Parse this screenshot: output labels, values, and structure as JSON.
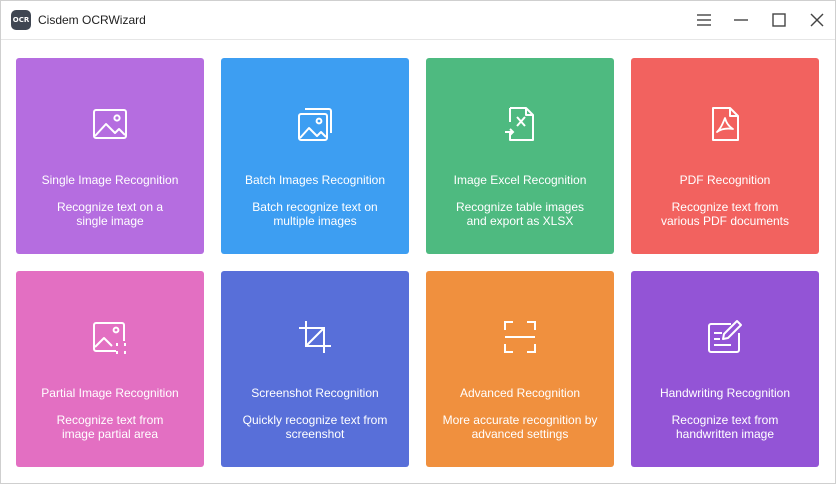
{
  "titlebar": {
    "logo_text": "OCR",
    "app_title": "Cisdem OCRWizard"
  },
  "colors": {
    "purple": "#b56de0",
    "blue": "#3d9ef2",
    "green": "#4eba80",
    "red": "#f2625f",
    "pink": "#e36fc2",
    "indigo": "#586fd9",
    "orange": "#f0903e",
    "violet": "#9354d6"
  },
  "cards": [
    {
      "title": "Single Image Recognition",
      "desc_line1": "Recognize text on a",
      "desc_line2": "single image",
      "icon": "image-icon",
      "color": "#b56de0"
    },
    {
      "title": "Batch Images Recognition",
      "desc_line1": "Batch recognize text on",
      "desc_line2": "multiple images",
      "icon": "images-stack-icon",
      "color": "#3d9ef2"
    },
    {
      "title": "Image Excel Recognition",
      "desc_line1": "Recognize table images",
      "desc_line2": "and export as XLSX",
      "icon": "excel-file-icon",
      "color": "#4eba80"
    },
    {
      "title": "PDF Recognition",
      "desc_line1": "Recognize text from",
      "desc_line2": "various PDF documents",
      "icon": "pdf-file-icon",
      "color": "#f2625f"
    },
    {
      "title": "Partial Image Recognition",
      "desc_line1": "Recognize text from",
      "desc_line2": "image partial area",
      "icon": "image-partial-icon",
      "color": "#e36fc2"
    },
    {
      "title": "Screenshot Recognition",
      "desc_line1": "Quickly recognize text from",
      "desc_line2": "screenshot",
      "icon": "crop-icon",
      "color": "#586fd9"
    },
    {
      "title": "Advanced Recognition",
      "desc_line1": "More accurate recognition by",
      "desc_line2": "advanced settings",
      "icon": "scan-frame-icon",
      "color": "#f0903e"
    },
    {
      "title": "Handwriting Recognition",
      "desc_line1": "Recognize text from",
      "desc_line2": "handwritten image",
      "icon": "edit-note-icon",
      "color": "#9354d6"
    }
  ]
}
